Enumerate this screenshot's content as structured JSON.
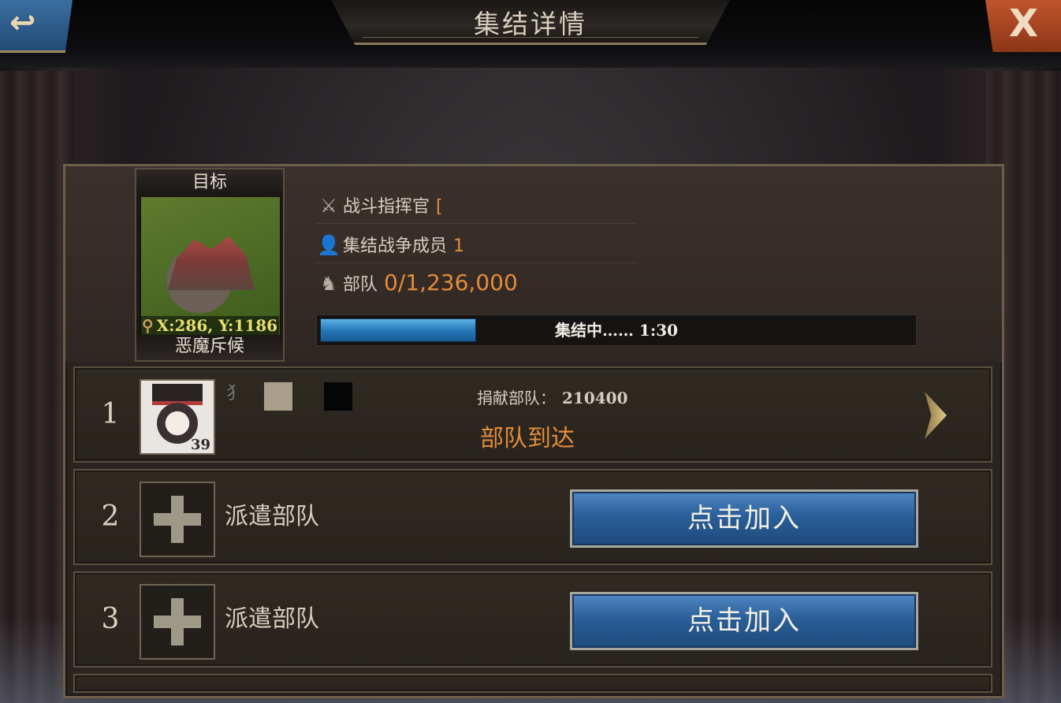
{
  "header": {
    "title": "集结详情",
    "back_icon": "back-arrow-icon",
    "close_label": "X"
  },
  "target": {
    "label": "目标",
    "coords": "X:286, Y:1186",
    "name": "恶魔斥候"
  },
  "rally_info": {
    "commander_label": "战斗指挥官",
    "commander_value": "[",
    "members_label": "集结战争成员",
    "members_value": "1",
    "troops_label": "部队",
    "troops_value": "0/1,236,000"
  },
  "progress": {
    "text": "集结中…… 1:30",
    "fraction": 0.26
  },
  "slots": [
    {
      "number": "1",
      "player_name": "犭",
      "level": "39",
      "contribution_label": "捐献部队：",
      "contribution_value": "210400",
      "status": "部队到达"
    },
    {
      "number": "2",
      "dispatch_label": "派遣部队",
      "join_label": "点击加入"
    },
    {
      "number": "3",
      "dispatch_label": "派遣部队",
      "join_label": "点击加入"
    }
  ],
  "colors": {
    "accent_orange": "#e58c3a",
    "progress_blue": "#2474b4",
    "coords_yellow": "#e6e06a"
  }
}
